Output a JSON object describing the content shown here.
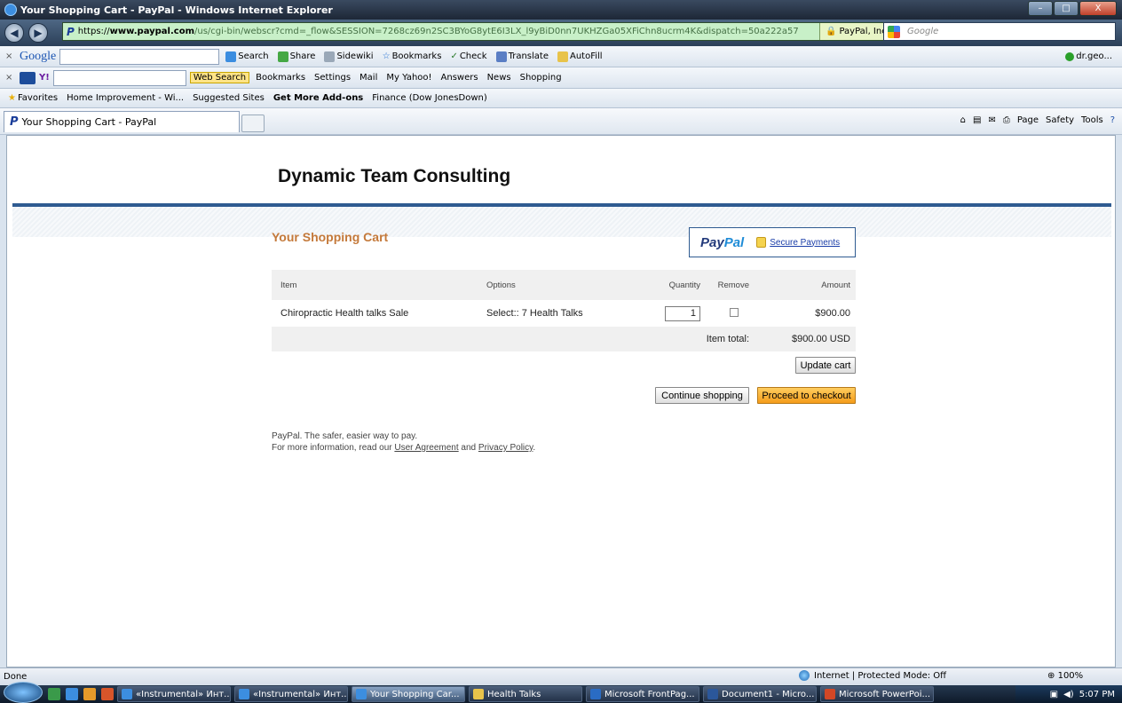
{
  "window": {
    "title": "Your Shopping Cart - PayPal - Windows Internet Explorer",
    "buttons": [
      "–",
      "□",
      "X"
    ]
  },
  "address_bar": {
    "scheme": "https://",
    "domain": "www.paypal.com",
    "path": "/us/cgi-bin/webscr?cmd=_flow&SESSION=7268cz69n2SC3BYoG8ytE6I3LX_l9yBiD0nn7UKHZGa05XFiChn8ucrm4K&dispatch=50a222a57",
    "cert_label": "PayPal, Inc. [US]",
    "search_placeholder": "Google"
  },
  "google_toolbar": {
    "brand": "Google",
    "items": [
      "Search",
      "Share",
      "Sidewiki",
      "Bookmarks",
      "Check",
      "Translate",
      "AutoFill"
    ],
    "account": "dr.geo..."
  },
  "yahoo_toolbar": {
    "web_search": "Web Search",
    "items": [
      "Bookmarks",
      "Settings",
      "Mail",
      "My Yahoo!",
      "Answers",
      "News",
      "Shopping"
    ]
  },
  "favorites_bar": {
    "favorites": "Favorites",
    "items": [
      "Home Improvement - Wi...",
      "Suggested Sites",
      "Get More Add-ons",
      "Finance (Dow JonesDown)"
    ]
  },
  "tab": {
    "label": "Your Shopping Cart - PayPal"
  },
  "command_bar": [
    "Page",
    "Safety",
    "Tools"
  ],
  "page": {
    "brand": "Dynamic Team Consulting",
    "cart_title": "Your Shopping Cart",
    "paypal_logo_a": "Pay",
    "paypal_logo_b": "Pal",
    "secure_payments": "Secure Payments",
    "table": {
      "headers": [
        "Item",
        "Options",
        "Quantity",
        "Remove",
        "Amount"
      ],
      "row": {
        "item": "Chiropractic Health talks Sale",
        "options": "Select:: 7 Health Talks",
        "quantity": "1",
        "amount": "$900.00"
      },
      "total_label": "Item total:",
      "total_value": "$900.00 USD"
    },
    "update_cart": "Update cart",
    "continue_shopping": "Continue shopping",
    "checkout": "Proceed to checkout",
    "footer": {
      "line1": "PayPal. The safer, easier way to pay.",
      "line2_prefix": "For more information, read our ",
      "user_agreement": "User Agreement",
      "and": " and ",
      "privacy_policy": "Privacy Policy",
      "period": "."
    }
  },
  "status_bar": {
    "left": "Done",
    "zone": "Internet | Protected Mode: Off",
    "zoom": "100%"
  },
  "taskbar": {
    "tasks": [
      "«Instrumental» Инт...",
      "«Instrumental» Инт...",
      "Your Shopping Car...",
      "Health Talks",
      "Microsoft FrontPag...",
      "Document1 - Micro...",
      "Microsoft PowerPoi..."
    ],
    "clock": "5:07 PM"
  }
}
